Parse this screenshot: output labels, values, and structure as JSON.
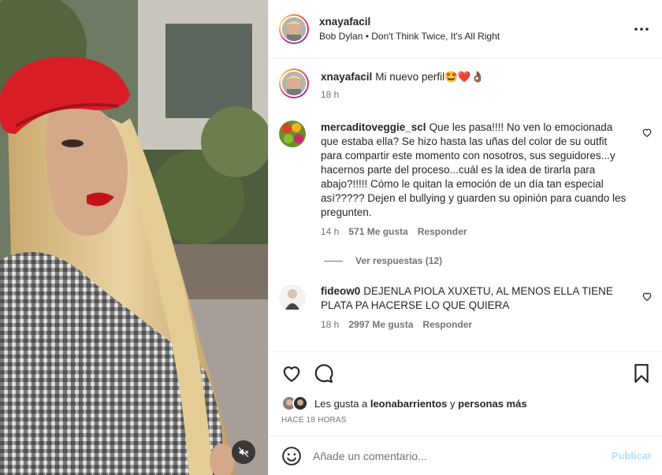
{
  "post": {
    "username": "xnayafacil",
    "audio": "Bob Dylan • Don't Think Twice, It's All Right",
    "caption": "Mi nuevo perfil",
    "caption_emojis": "🤩❤️👌🏾",
    "caption_time": "18 h"
  },
  "comments": [
    {
      "username": "mercaditoveggie_scl",
      "text": "Que les pasa!!!! No ven lo emocionada que estaba ella? Se hizo hasta las uñas del color de su outfit para compartir este momento con nosotros, sus seguidores...y hacernos parte del proceso...cuál es la idea de tirarla para abajo?!!!!! Cómo le quitan la emoción de un día tan especial así????? Dejen el bullying y guarden su opinión para cuando les pregunten.",
      "time": "14 h",
      "likes": "571 Me gusta",
      "reply": "Responder",
      "view_replies": "Ver respuestas (12)"
    },
    {
      "username": "fideow0",
      "text": "DEJENLA PIOLA XUXETU, AL MENOS ELLA TIENE PLATA PA HACERSE LO QUE QUIERA",
      "time": "18 h",
      "likes": "2997 Me gusta",
      "reply": "Responder"
    }
  ],
  "likes_line": {
    "prefix": "Les gusta a",
    "user": "leonabarrientos",
    "joiner": "y",
    "others": "personas más"
  },
  "time_ago": "HACE 18 HORAS",
  "composer": {
    "placeholder": "Añade un comentario...",
    "publish": "Publicar"
  },
  "icons": {
    "more": "more-horizontal-icon",
    "like": "heart-icon",
    "comment": "comment-bubble-icon",
    "save": "bookmark-icon",
    "mute": "speaker-muted-icon",
    "emoji": "emoji-smile-icon"
  },
  "colors": {
    "text": "#262626",
    "secondary": "#737373",
    "border": "#efefef",
    "publish_disabled": "#b2dffc"
  }
}
